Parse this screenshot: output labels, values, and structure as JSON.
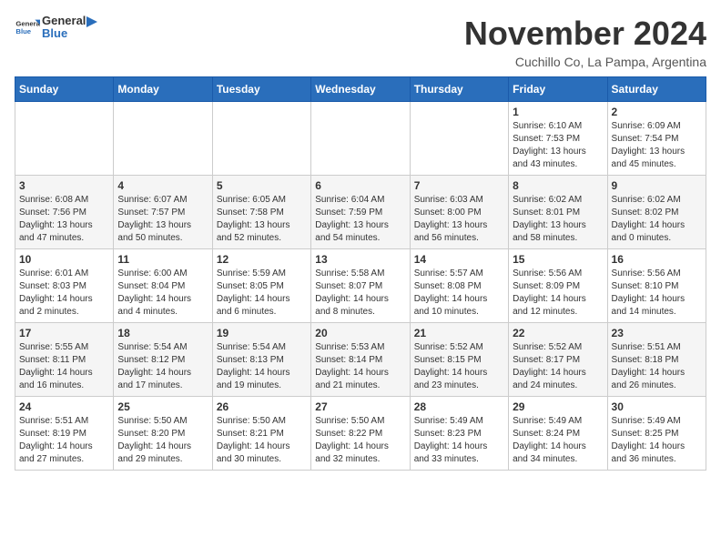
{
  "header": {
    "logo_general": "General",
    "logo_blue": "Blue",
    "month": "November 2024",
    "location": "Cuchillo Co, La Pampa, Argentina"
  },
  "weekdays": [
    "Sunday",
    "Monday",
    "Tuesday",
    "Wednesday",
    "Thursday",
    "Friday",
    "Saturday"
  ],
  "weeks": [
    [
      {
        "day": "",
        "info": ""
      },
      {
        "day": "",
        "info": ""
      },
      {
        "day": "",
        "info": ""
      },
      {
        "day": "",
        "info": ""
      },
      {
        "day": "",
        "info": ""
      },
      {
        "day": "1",
        "info": "Sunrise: 6:10 AM\nSunset: 7:53 PM\nDaylight: 13 hours\nand 43 minutes."
      },
      {
        "day": "2",
        "info": "Sunrise: 6:09 AM\nSunset: 7:54 PM\nDaylight: 13 hours\nand 45 minutes."
      }
    ],
    [
      {
        "day": "3",
        "info": "Sunrise: 6:08 AM\nSunset: 7:56 PM\nDaylight: 13 hours\nand 47 minutes."
      },
      {
        "day": "4",
        "info": "Sunrise: 6:07 AM\nSunset: 7:57 PM\nDaylight: 13 hours\nand 50 minutes."
      },
      {
        "day": "5",
        "info": "Sunrise: 6:05 AM\nSunset: 7:58 PM\nDaylight: 13 hours\nand 52 minutes."
      },
      {
        "day": "6",
        "info": "Sunrise: 6:04 AM\nSunset: 7:59 PM\nDaylight: 13 hours\nand 54 minutes."
      },
      {
        "day": "7",
        "info": "Sunrise: 6:03 AM\nSunset: 8:00 PM\nDaylight: 13 hours\nand 56 minutes."
      },
      {
        "day": "8",
        "info": "Sunrise: 6:02 AM\nSunset: 8:01 PM\nDaylight: 13 hours\nand 58 minutes."
      },
      {
        "day": "9",
        "info": "Sunrise: 6:02 AM\nSunset: 8:02 PM\nDaylight: 14 hours\nand 0 minutes."
      }
    ],
    [
      {
        "day": "10",
        "info": "Sunrise: 6:01 AM\nSunset: 8:03 PM\nDaylight: 14 hours\nand 2 minutes."
      },
      {
        "day": "11",
        "info": "Sunrise: 6:00 AM\nSunset: 8:04 PM\nDaylight: 14 hours\nand 4 minutes."
      },
      {
        "day": "12",
        "info": "Sunrise: 5:59 AM\nSunset: 8:05 PM\nDaylight: 14 hours\nand 6 minutes."
      },
      {
        "day": "13",
        "info": "Sunrise: 5:58 AM\nSunset: 8:07 PM\nDaylight: 14 hours\nand 8 minutes."
      },
      {
        "day": "14",
        "info": "Sunrise: 5:57 AM\nSunset: 8:08 PM\nDaylight: 14 hours\nand 10 minutes."
      },
      {
        "day": "15",
        "info": "Sunrise: 5:56 AM\nSunset: 8:09 PM\nDaylight: 14 hours\nand 12 minutes."
      },
      {
        "day": "16",
        "info": "Sunrise: 5:56 AM\nSunset: 8:10 PM\nDaylight: 14 hours\nand 14 minutes."
      }
    ],
    [
      {
        "day": "17",
        "info": "Sunrise: 5:55 AM\nSunset: 8:11 PM\nDaylight: 14 hours\nand 16 minutes."
      },
      {
        "day": "18",
        "info": "Sunrise: 5:54 AM\nSunset: 8:12 PM\nDaylight: 14 hours\nand 17 minutes."
      },
      {
        "day": "19",
        "info": "Sunrise: 5:54 AM\nSunset: 8:13 PM\nDaylight: 14 hours\nand 19 minutes."
      },
      {
        "day": "20",
        "info": "Sunrise: 5:53 AM\nSunset: 8:14 PM\nDaylight: 14 hours\nand 21 minutes."
      },
      {
        "day": "21",
        "info": "Sunrise: 5:52 AM\nSunset: 8:15 PM\nDaylight: 14 hours\nand 23 minutes."
      },
      {
        "day": "22",
        "info": "Sunrise: 5:52 AM\nSunset: 8:17 PM\nDaylight: 14 hours\nand 24 minutes."
      },
      {
        "day": "23",
        "info": "Sunrise: 5:51 AM\nSunset: 8:18 PM\nDaylight: 14 hours\nand 26 minutes."
      }
    ],
    [
      {
        "day": "24",
        "info": "Sunrise: 5:51 AM\nSunset: 8:19 PM\nDaylight: 14 hours\nand 27 minutes."
      },
      {
        "day": "25",
        "info": "Sunrise: 5:50 AM\nSunset: 8:20 PM\nDaylight: 14 hours\nand 29 minutes."
      },
      {
        "day": "26",
        "info": "Sunrise: 5:50 AM\nSunset: 8:21 PM\nDaylight: 14 hours\nand 30 minutes."
      },
      {
        "day": "27",
        "info": "Sunrise: 5:50 AM\nSunset: 8:22 PM\nDaylight: 14 hours\nand 32 minutes."
      },
      {
        "day": "28",
        "info": "Sunrise: 5:49 AM\nSunset: 8:23 PM\nDaylight: 14 hours\nand 33 minutes."
      },
      {
        "day": "29",
        "info": "Sunrise: 5:49 AM\nSunset: 8:24 PM\nDaylight: 14 hours\nand 34 minutes."
      },
      {
        "day": "30",
        "info": "Sunrise: 5:49 AM\nSunset: 8:25 PM\nDaylight: 14 hours\nand 36 minutes."
      }
    ]
  ]
}
